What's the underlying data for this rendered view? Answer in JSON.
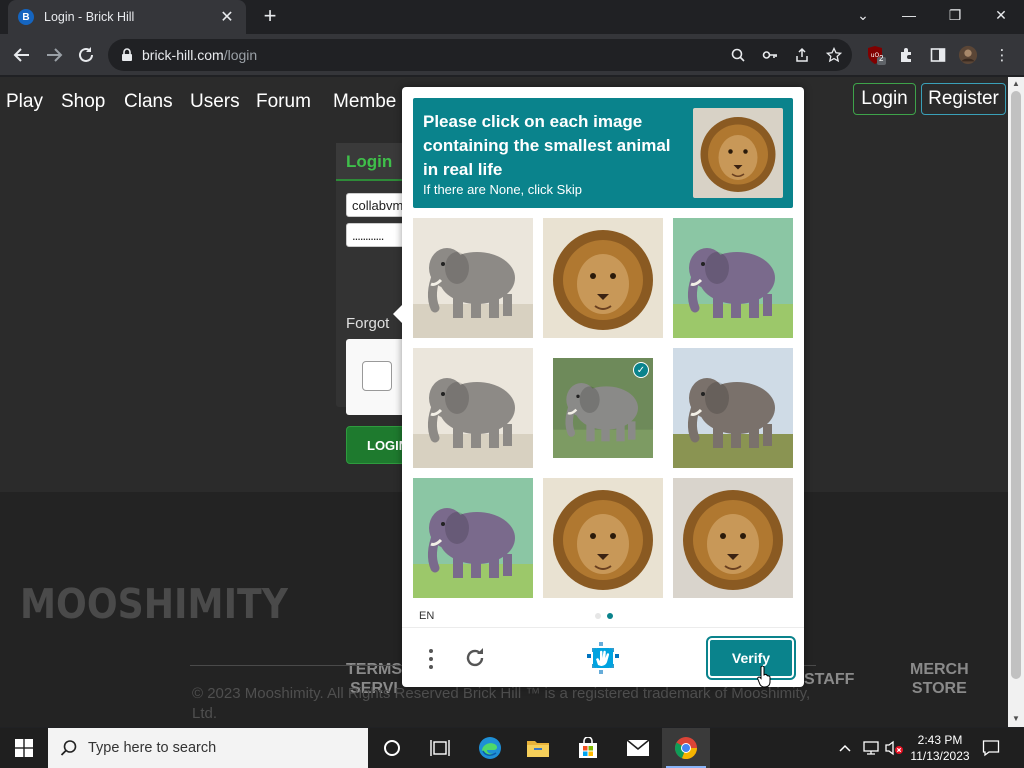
{
  "browser": {
    "tab_title": "Login - Brick Hill",
    "favicon_letter": "B",
    "url_host": "brick-hill.com",
    "url_path": "/login",
    "extension_badge": "2"
  },
  "site": {
    "nav": [
      "Play",
      "Shop",
      "Clans",
      "Users",
      "Forum",
      "Membe"
    ],
    "login_label": "Login",
    "register_label": "Register",
    "login_card": {
      "title": "Login",
      "username_value": "collabvm",
      "password_value": "............",
      "forgot_text": "Forgot",
      "login_button": "LOGIN"
    },
    "footer": {
      "logo_text": "MOOSHIMITY",
      "links": [
        "TERMS\nSERVI",
        "STAFF",
        "MERCH\nSTORE"
      ],
      "copyright": "© 2023 Mooshimity. All Rights Reserved Brick Hill ™ is a registered trademark of Mooshimity, Ltd."
    }
  },
  "captcha": {
    "prompt": "Please click on each image containing the smallest animal in real life",
    "subprompt": "If there are None, click Skip",
    "sample_image": "lion",
    "grid": [
      {
        "animal": "elephant",
        "style": "photo",
        "selected": false
      },
      {
        "animal": "lion",
        "style": "photo",
        "selected": false
      },
      {
        "animal": "elephant",
        "style": "painting",
        "selected": false
      },
      {
        "animal": "elephant",
        "style": "photo",
        "selected": false
      },
      {
        "animal": "elephant",
        "style": "photo",
        "selected": true
      },
      {
        "animal": "elephant",
        "style": "photo",
        "selected": false
      },
      {
        "animal": "elephant",
        "style": "painting",
        "selected": false
      },
      {
        "animal": "lion",
        "style": "photo",
        "selected": false
      },
      {
        "animal": "lion",
        "style": "photo",
        "selected": false
      }
    ],
    "language": "EN",
    "verify_label": "Verify",
    "pages_total": 2,
    "page_current": 2
  },
  "taskbar": {
    "search_placeholder": "Type here to search",
    "time": "2:43 PM",
    "date": "11/13/2023"
  },
  "colors": {
    "captcha_teal": "#0a838c",
    "site_green": "#3fbf4a",
    "page_bg": "#2b2b2b"
  }
}
